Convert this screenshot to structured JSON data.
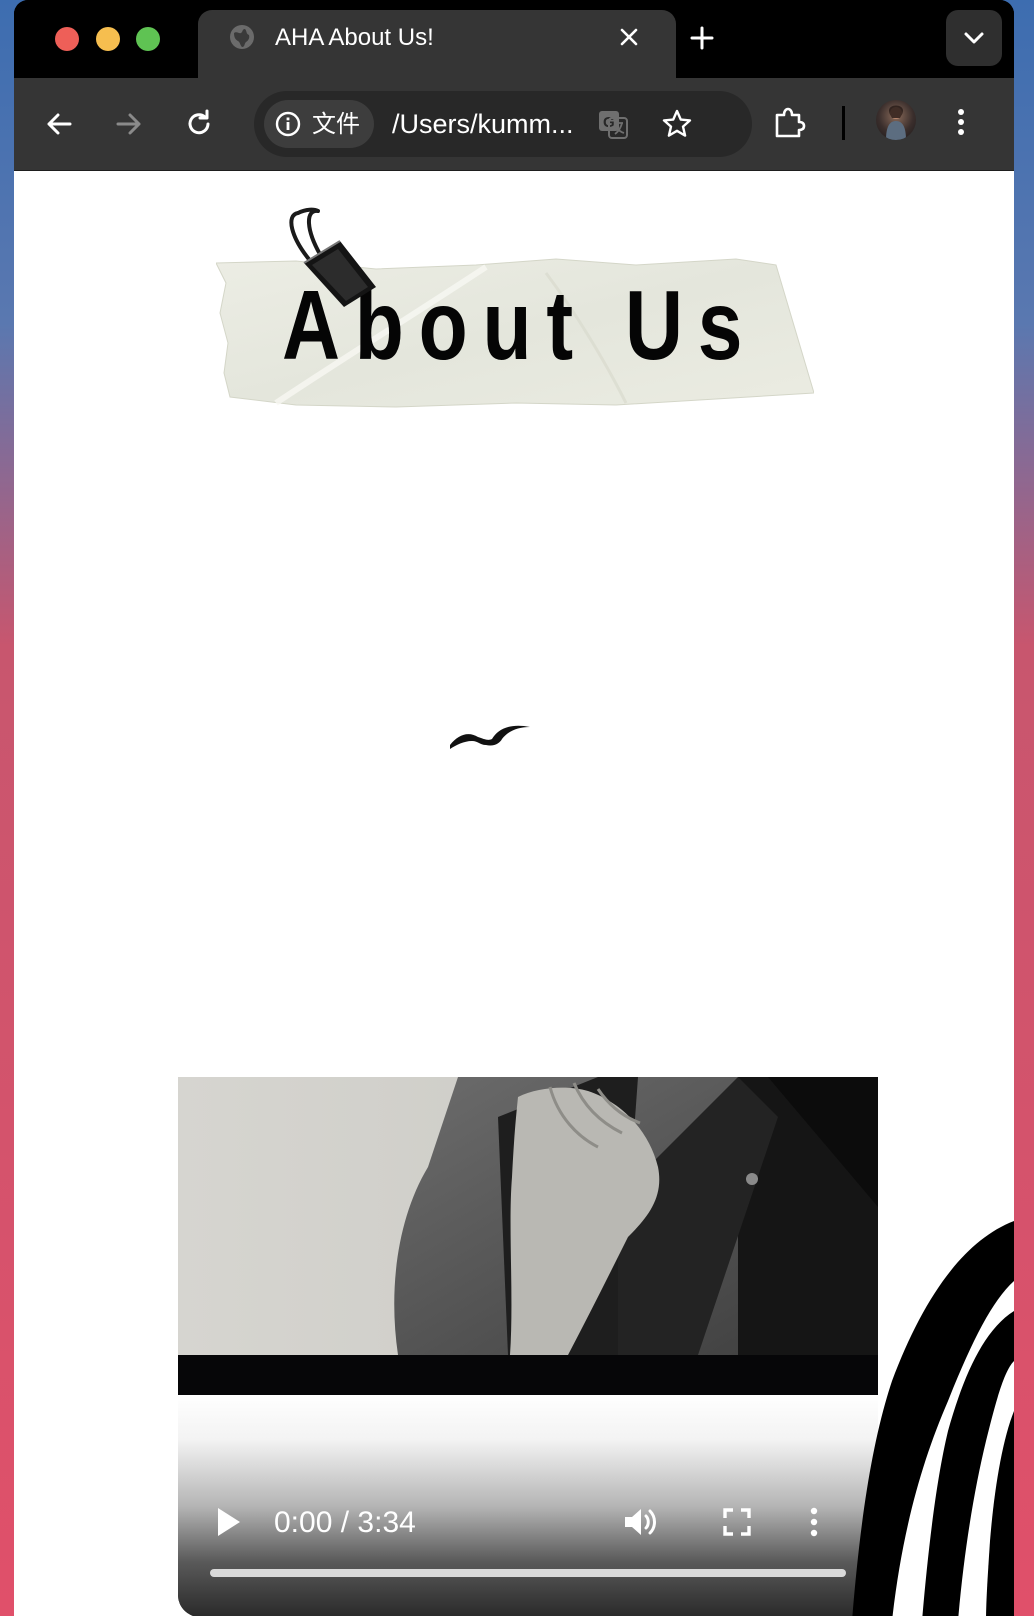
{
  "browser": {
    "tab": {
      "title": "AHA About Us!",
      "icon": "globe-icon"
    },
    "site_chip_label": "文件",
    "url": "/Users/kumm...",
    "icons": {
      "back": "arrow-left-icon",
      "forward": "arrow-right-icon",
      "reload": "reload-icon",
      "translate": "translate-icon",
      "bookmark": "star-icon",
      "extensions": "puzzle-icon",
      "menu": "kebab-menu-icon",
      "new_tab": "plus-icon",
      "tab_search": "chevron-down-icon",
      "close_tab": "close-icon",
      "site_info": "info-icon"
    },
    "colors": {
      "chrome_dark": "#353535",
      "tab_strip": "#000000",
      "omnibox": "#282828"
    }
  },
  "page": {
    "heading": "About Us",
    "decor": {
      "clip": "binder-clip-icon",
      "bird": "bird-icon",
      "tape": "paper-tape"
    },
    "video": {
      "current_time": "0:00",
      "separator": "/",
      "duration": "3:34",
      "progress": 0,
      "icons": {
        "play": "play-icon",
        "volume": "volume-icon",
        "fullscreen": "fullscreen-icon",
        "more": "more-vertical-icon"
      }
    }
  }
}
